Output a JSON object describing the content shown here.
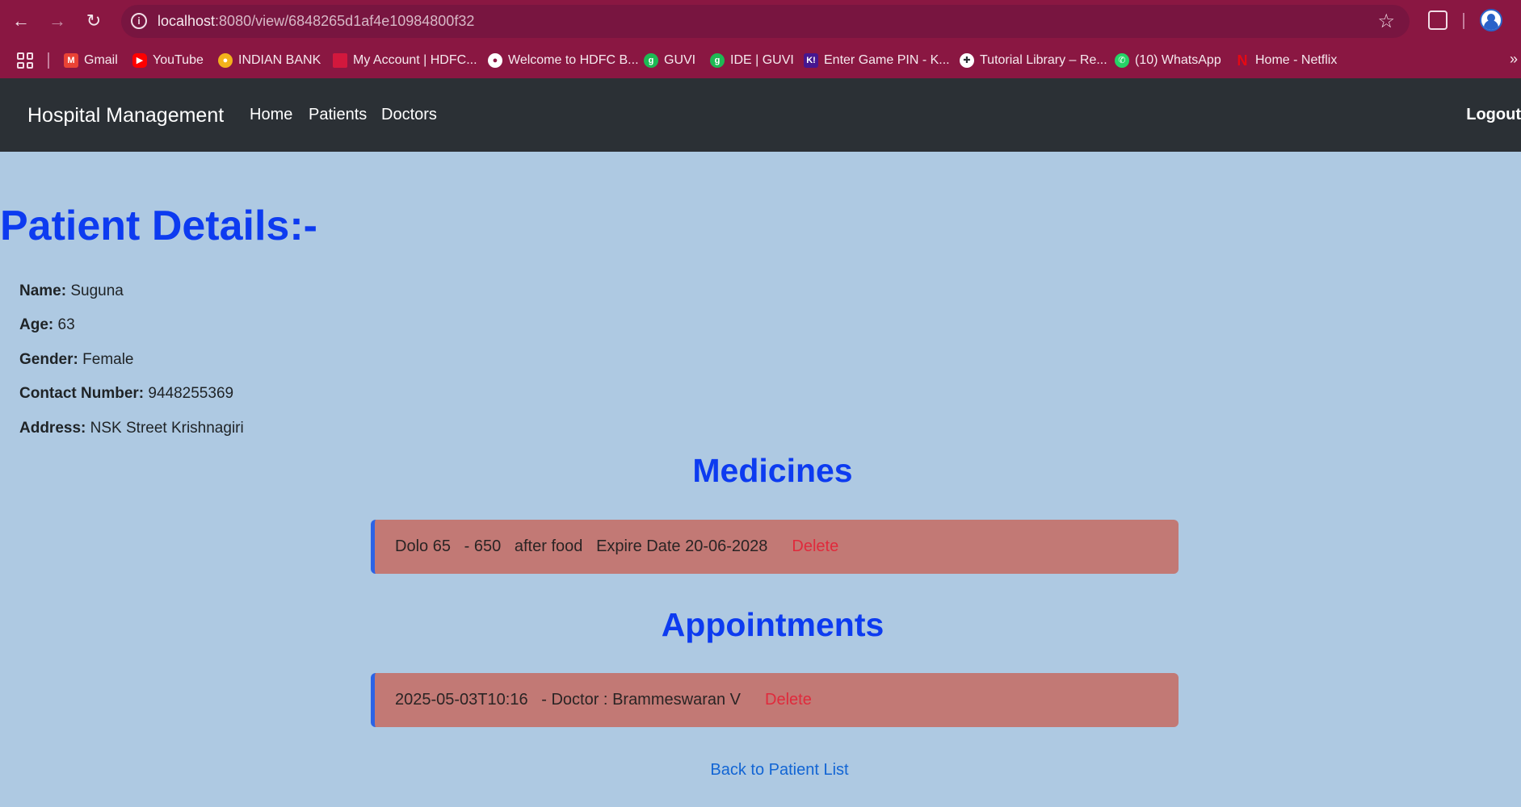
{
  "browser": {
    "url_host": "localhost",
    "url_path": ":8080/view/6848265d1af4e10984800f32",
    "bookmarks": [
      {
        "label": "Gmail",
        "icon": "gmail-icon",
        "color": "#ea4335"
      },
      {
        "label": "YouTube",
        "icon": "youtube-icon",
        "color": "#ff0000"
      },
      {
        "label": "INDIAN BANK",
        "icon": "indian-bank-icon",
        "color": "#f2b21b"
      },
      {
        "label": "My Account | HDFC...",
        "icon": "hdfc-icon",
        "color": "#d2183d"
      },
      {
        "label": "Welcome to HDFC B...",
        "icon": "globe-icon",
        "color": "#ffffff"
      },
      {
        "label": "GUVI",
        "icon": "guvi-icon",
        "color": "#1db954"
      },
      {
        "label": "IDE | GUVI",
        "icon": "guvi-icon",
        "color": "#1db954"
      },
      {
        "label": "Enter Game PIN - K...",
        "icon": "kahoot-icon",
        "color": "#46178f"
      },
      {
        "label": "Tutorial Library – Re...",
        "icon": "tutorial-icon",
        "color": "#ffffff"
      },
      {
        "label": "(10) WhatsApp",
        "icon": "whatsapp-icon",
        "color": "#25d366"
      },
      {
        "label": "Home - Netflix",
        "icon": "netflix-icon",
        "color": "#e50914"
      }
    ]
  },
  "navbar": {
    "brand": "Hospital Management",
    "links": [
      "Home",
      "Patients",
      "Doctors"
    ],
    "logout": "Logout"
  },
  "page": {
    "title": "Patient Details:-",
    "fields": [
      {
        "label": "Name:",
        "value": "Suguna"
      },
      {
        "label": "Age:",
        "value": "63"
      },
      {
        "label": "Gender:",
        "value": "Female"
      },
      {
        "label": "Contact Number:",
        "value": "9448255369"
      },
      {
        "label": "Address:",
        "value": "NSK Street Krishnagiri"
      }
    ],
    "medicines_title": "Medicines",
    "medicine": {
      "name": "Dolo 65",
      "dose": "- 650",
      "timing": "after food",
      "expiry": "Expire Date 20-06-2028",
      "delete": "Delete"
    },
    "appointments_title": "Appointments",
    "appointment": {
      "datetime": "2025-05-03T10:16",
      "doctor_label": "- Doctor :",
      "doctor": "Brammeswaran V",
      "delete": "Delete"
    },
    "back_link": "Back to Patient List"
  }
}
